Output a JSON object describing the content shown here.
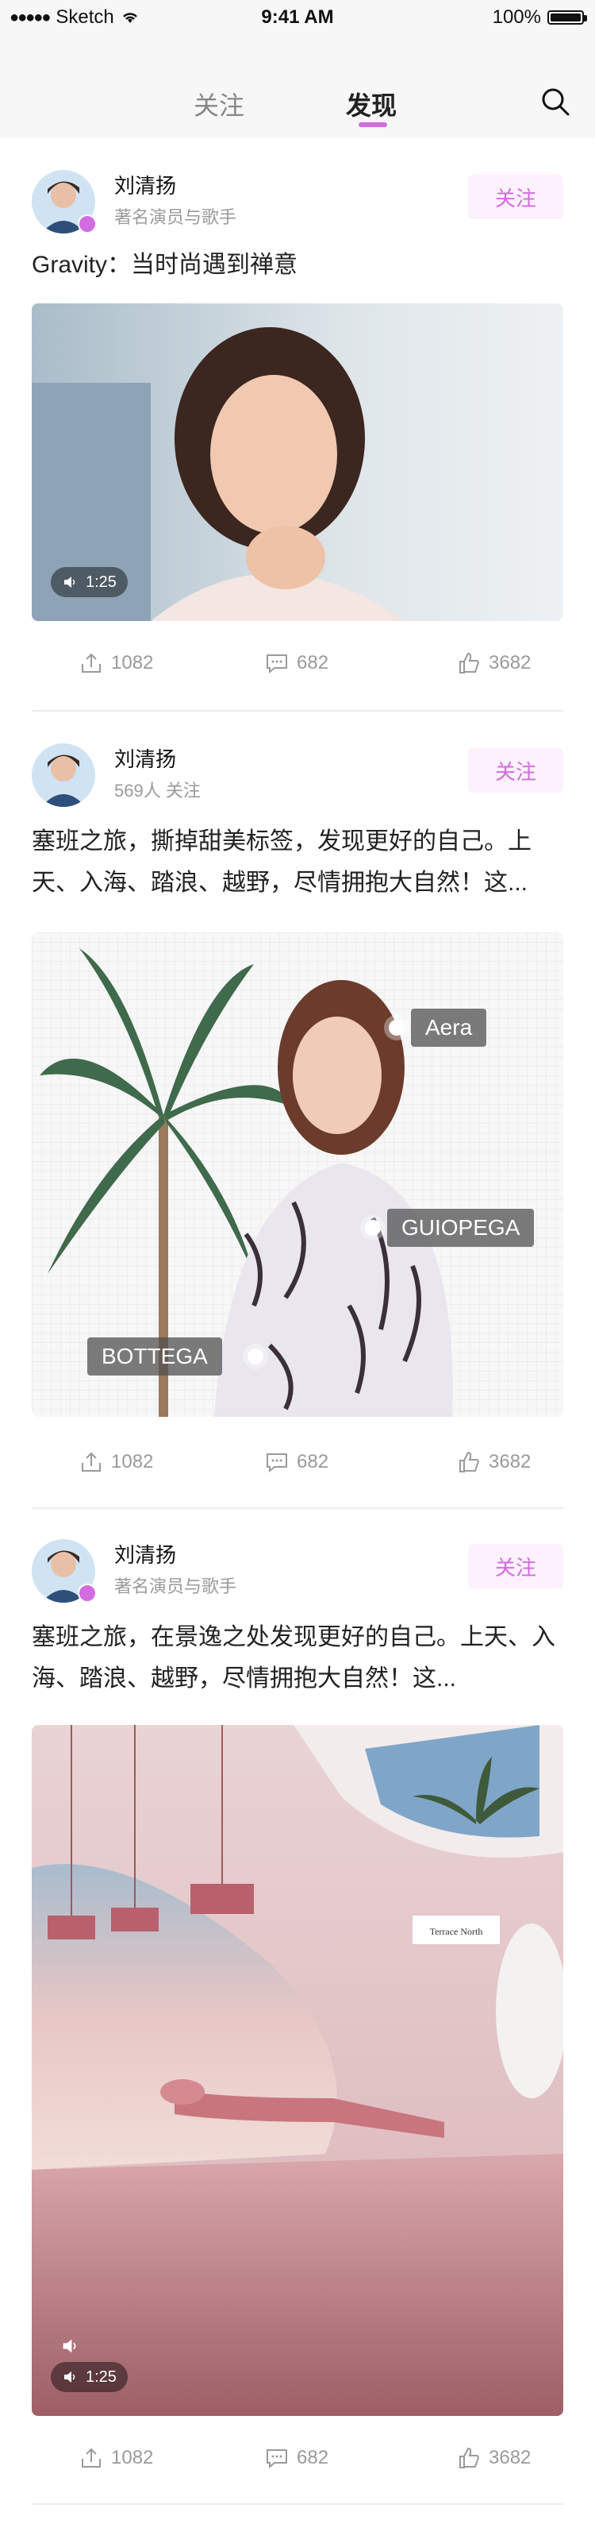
{
  "status_bar": {
    "carrier": "Sketch",
    "time": "9:41 AM",
    "battery": "100%"
  },
  "header": {
    "tabs": [
      {
        "label": "关注"
      },
      {
        "label": "发现"
      }
    ]
  },
  "colors": {
    "accent": "#d26ce0",
    "follow_bg": "#fdf1fe",
    "muted": "#9a9a9a",
    "divider": "#ececec"
  },
  "posts": [
    {
      "name": "刘清扬",
      "subtitle": "著名演员与歌手",
      "follow_label": "关注",
      "text": "Gravity：当时尚遇到禅意",
      "media": {
        "type": "video",
        "duration": "1:25"
      },
      "actions": {
        "share": "1082",
        "comment": "682",
        "like": "3682"
      }
    },
    {
      "name": "刘清扬",
      "subtitle": "569人 关注",
      "follow_label": "关注",
      "text": "塞班之旅，撕掉甜美标签，发现更好的自己。上天、入海、踏浪、越野，尽情拥抱大自然！这...",
      "media": {
        "type": "image",
        "tags": [
          {
            "label": "Aera"
          },
          {
            "label": "GUIOPEGA"
          },
          {
            "label": "BOTTEGA"
          }
        ]
      },
      "actions": {
        "share": "1082",
        "comment": "682",
        "like": "3682"
      }
    },
    {
      "name": "刘清扬",
      "subtitle": "著名演员与歌手",
      "follow_label": "关注",
      "text": "塞班之旅，在景逸之处发现更好的自己。上天、入海、踏浪、越野，尽情拥抱大自然！这...",
      "media": {
        "type": "video",
        "duration": "1:25",
        "sign": "Terrace North"
      },
      "actions": {
        "share": "1082",
        "comment": "682",
        "like": "3682"
      }
    }
  ]
}
